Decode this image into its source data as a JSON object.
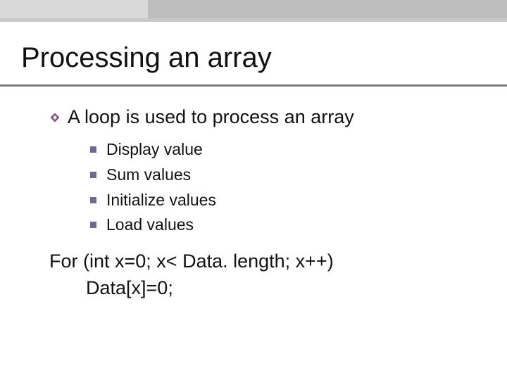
{
  "title": "Processing an array",
  "bullet": {
    "text": "A loop is used to process an array",
    "subitems": [
      "Display value",
      "Sum values",
      "Initialize values",
      "Load values"
    ]
  },
  "code": {
    "line1": "For (int x=0; x< Data. length; x++)",
    "line2": "Data[x]=0;"
  }
}
